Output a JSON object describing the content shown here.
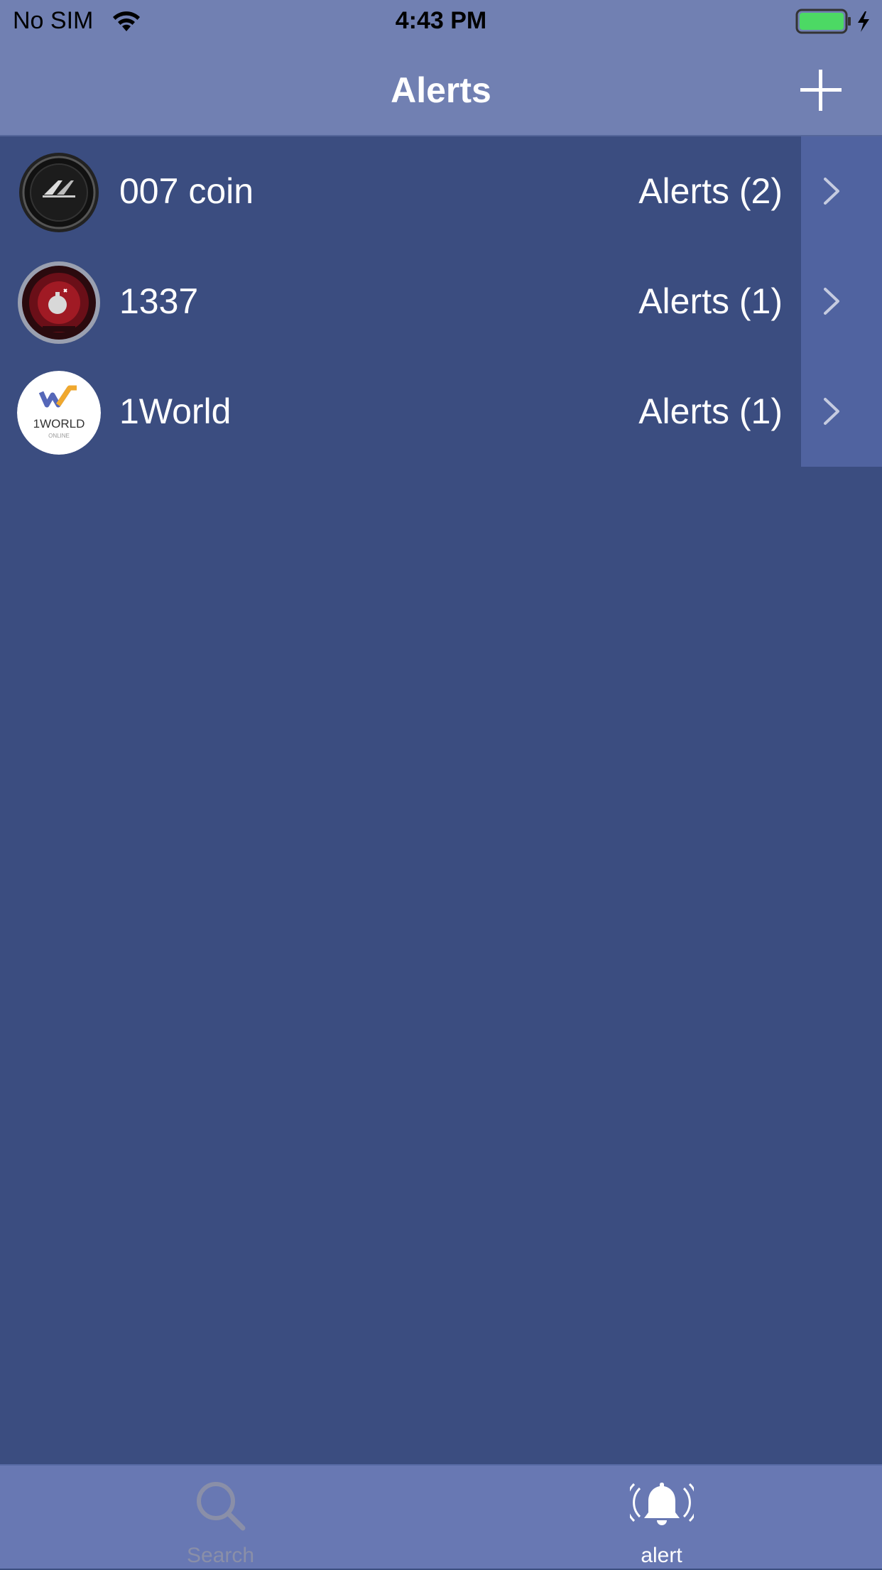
{
  "status_bar": {
    "carrier": "No SIM",
    "time": "4:43 PM",
    "battery_color": "#4cd964"
  },
  "nav": {
    "title": "Alerts",
    "add_icon": "plus-icon"
  },
  "alerts_list": [
    {
      "name": "007 coin",
      "alerts": "Alerts (2)",
      "icon": "007-coin-logo"
    },
    {
      "name": "1337",
      "alerts": "Alerts (1)",
      "icon": "1337-logo"
    },
    {
      "name": "1World",
      "alerts": "Alerts (1)",
      "icon": "1world-logo",
      "logo_text": "1WORLD",
      "logo_subtext": "ONLINE"
    }
  ],
  "tabs": [
    {
      "label": "Search",
      "icon": "search-icon",
      "active": false
    },
    {
      "label": "alert",
      "icon": "bell-icon",
      "active": true
    }
  ],
  "colors": {
    "background": "#3b4d80",
    "header": "#7180b2",
    "tab_bar": "#6878b3",
    "accessory": "#5063a0"
  }
}
